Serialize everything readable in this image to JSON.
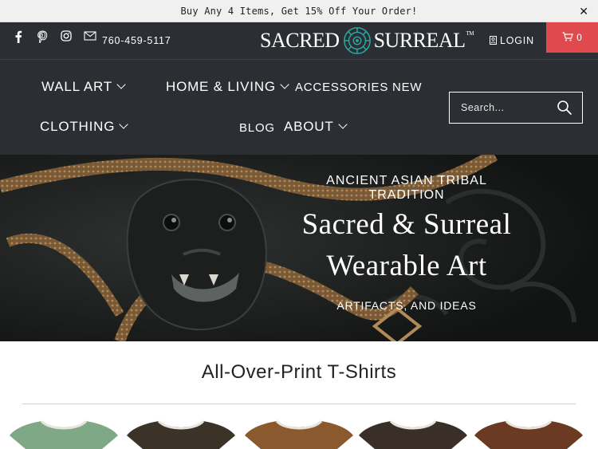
{
  "announcement": {
    "text": "Buy Any 4 Items, Get 15% Off Your Order!",
    "close_label": "✕"
  },
  "header": {
    "social": [
      "facebook-icon",
      "pinterest-icon",
      "instagram-icon",
      "email-icon"
    ],
    "phone": "760-459-5117",
    "logo": {
      "left": "SACRED",
      "right": "SURREAL",
      "tm": "TM"
    },
    "login_label": "LOGIN",
    "cart_count": "0"
  },
  "nav": {
    "wall_art": "WALL ART",
    "home_living": "HOME & LIVING",
    "accessories": "ACCESSORIES",
    "new": "NEW",
    "clothing": "CLOTHING",
    "blog": "BLOG",
    "about": "ABOUT"
  },
  "search": {
    "placeholder": "Search..."
  },
  "hero": {
    "kicker": "ANCIENT ASIAN TRIBAL TRADITION",
    "title_line1": "Sacred & Surreal",
    "title_line2": "Wearable Art",
    "subtitle": "ARTIFACTS, AND IDEAS"
  },
  "section": {
    "title": "All-Over-Print T-Shirts"
  },
  "products": [
    {
      "name": "tshirt-1",
      "color": "#7fa886"
    },
    {
      "name": "tshirt-2",
      "color": "#3b3328"
    },
    {
      "name": "tshirt-3",
      "color": "#8a5a2e"
    },
    {
      "name": "tshirt-4",
      "color": "#3a2f28"
    },
    {
      "name": "tshirt-5",
      "color": "#6b3a22"
    }
  ],
  "colors": {
    "header_bg": "#2b2e33",
    "cart_bg": "#e0494d",
    "accent_teal": "#2aa6a0"
  }
}
